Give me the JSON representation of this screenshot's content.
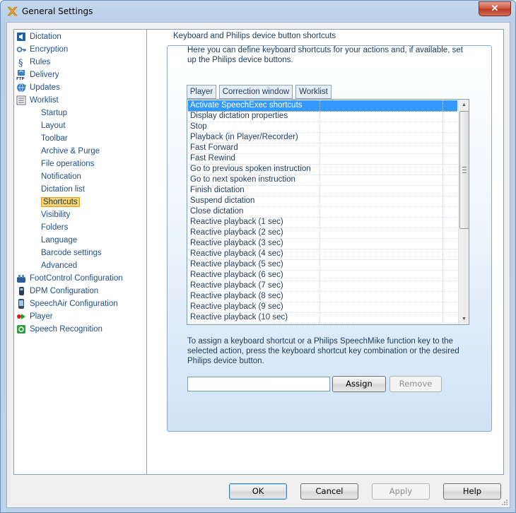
{
  "window": {
    "title": "General Settings",
    "close_glyph": "✕"
  },
  "nav": {
    "items": [
      {
        "label": "Dictation",
        "icon": "speaker-icon",
        "level": 0
      },
      {
        "label": "Encryption",
        "icon": "key-icon",
        "level": 0
      },
      {
        "label": "Rules",
        "icon": "paragraph-icon",
        "level": 0
      },
      {
        "label": "Delivery",
        "icon": "ftp-icon",
        "level": 0
      },
      {
        "label": "Updates",
        "icon": "globe-icon",
        "level": 0
      },
      {
        "label": "Worklist",
        "icon": "list-icon",
        "level": 0
      },
      {
        "label": "Startup",
        "level": 1
      },
      {
        "label": "Layout",
        "level": 1
      },
      {
        "label": "Toolbar",
        "level": 1
      },
      {
        "label": "Archive & Purge",
        "level": 1
      },
      {
        "label": "File operations",
        "level": 1
      },
      {
        "label": "Notification",
        "level": 1
      },
      {
        "label": "Dictation list",
        "level": 1
      },
      {
        "label": "Shortcuts",
        "level": 1,
        "selected": true
      },
      {
        "label": "Visibility",
        "level": 1
      },
      {
        "label": "Folders",
        "level": 1
      },
      {
        "label": "Language",
        "level": 1
      },
      {
        "label": "Barcode settings",
        "level": 1
      },
      {
        "label": "Advanced",
        "level": 1
      },
      {
        "label": "FootControl Configuration",
        "icon": "footcontrol-icon",
        "level": 0
      },
      {
        "label": "DPM Configuration",
        "icon": "recorder-icon",
        "level": 0
      },
      {
        "label": "SpeechAir Configuration",
        "icon": "phone-icon",
        "level": 0
      },
      {
        "label": "Player",
        "icon": "player-icon",
        "level": 0
      },
      {
        "label": "Speech Recognition",
        "icon": "gear-icon",
        "level": 0
      }
    ]
  },
  "shortcuts": {
    "group_title": "Keyboard and Philips device button shortcuts",
    "intro": "Here you can define keyboard shortcuts for your actions and, if available, set up the Philips device buttons.",
    "tabs": [
      "Player",
      "Correction window",
      "Worklist"
    ],
    "actions": [
      "Activate SpeechExec shortcuts",
      "Display dictation properties",
      "Stop",
      "Playback (in Player/Recorder)",
      "Fast Forward",
      "Fast Rewind",
      "Go to previous spoken instruction",
      "Go to next spoken instruction",
      "Finish dictation",
      "Suspend dictation",
      "Close dictation",
      "Reactive playback (1 sec)",
      "Reactive playback (2 sec)",
      "Reactive playback (3 sec)",
      "Reactive playback (4 sec)",
      "Reactive playback (5 sec)",
      "Reactive playback (6 sec)",
      "Reactive playback (7 sec)",
      "Reactive playback (8 sec)",
      "Reactive playback (9 sec)",
      "Reactive playback (10 sec)"
    ],
    "selected_index": 0,
    "hint": "To assign a keyboard shortcut or a Philips SpeechMike function key to the selected action, press the keyboard shortcut key combination or the desired Philips device button.",
    "shortcut_value": "",
    "assign_label": "Assign",
    "remove_label": "Remove"
  },
  "footer": {
    "ok_label": "OK",
    "cancel_label": "Cancel",
    "apply_label": "Apply",
    "help_label": "Help"
  },
  "colors": {
    "accent": "#3399ff",
    "tree_selection": "#f6d36b",
    "link_blue": "#1e4f8c"
  }
}
